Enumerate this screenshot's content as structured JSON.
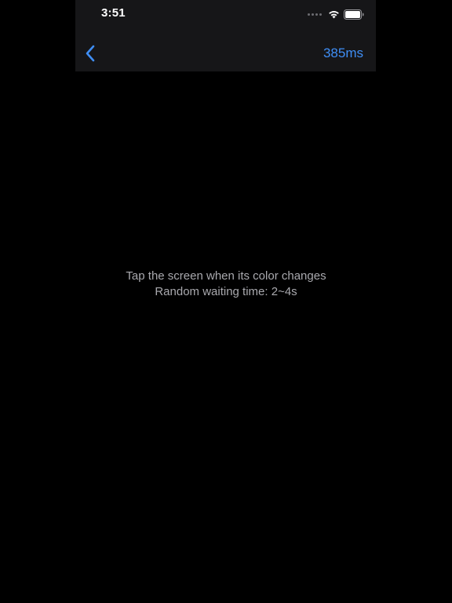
{
  "status_bar": {
    "time": "3:51",
    "icons": [
      "signal-dots-icon",
      "wifi-icon",
      "battery-icon"
    ]
  },
  "nav": {
    "back_icon": "chevron-left-icon",
    "result": "385ms",
    "accent_color": "#3f8ef5"
  },
  "main": {
    "instruction_line1": "Tap the screen when its color changes",
    "instruction_line2": "Random waiting time: 2~4s",
    "background_color": "#000000"
  }
}
